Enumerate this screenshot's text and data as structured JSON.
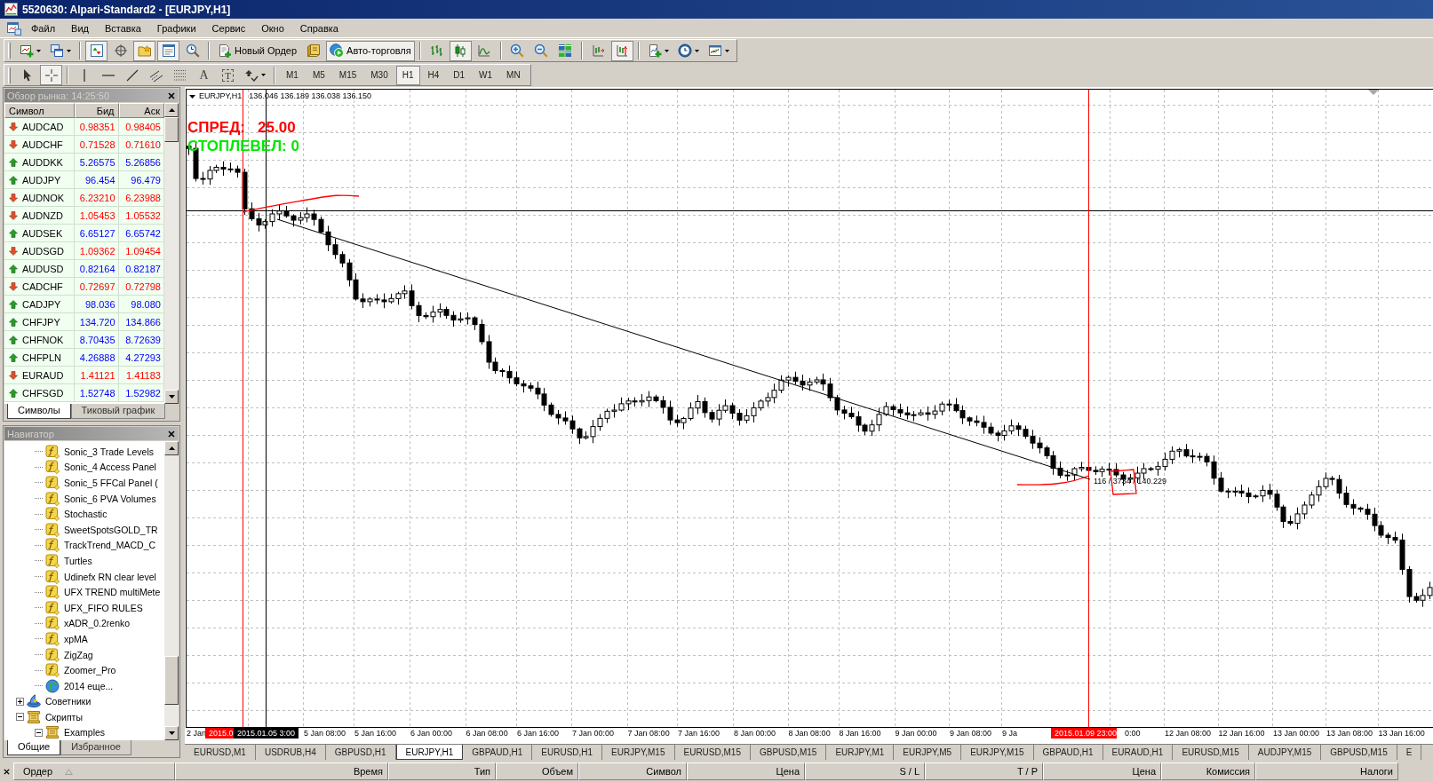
{
  "window": {
    "title": "5520630: Alpari-Standard2 - [EURJPY,H1]"
  },
  "menu": [
    "Файл",
    "Вид",
    "Вставка",
    "Графики",
    "Сервис",
    "Окно",
    "Справка"
  ],
  "toolbar": [
    [
      {
        "kind": "new-chart",
        "on": false
      },
      {
        "kind": "profiles",
        "on": false
      }
    ],
    [
      {
        "kind": "market-watch",
        "on": true
      },
      {
        "kind": "data-window",
        "on": false
      },
      {
        "kind": "navigator",
        "on": true
      },
      {
        "kind": "terminal",
        "on": true
      },
      {
        "kind": "strategy-tester",
        "on": false
      }
    ],
    [
      {
        "kind": "new-order",
        "label": "Новый Ордер",
        "on": false
      },
      {
        "kind": "meta-editor",
        "on": false
      },
      {
        "kind": "auto-trading",
        "label": "Авто-торговля",
        "on": true
      }
    ],
    [
      {
        "kind": "bar-chart",
        "on": false
      },
      {
        "kind": "candlesticks",
        "on": true
      },
      {
        "kind": "line-chart",
        "on": false
      }
    ],
    [
      {
        "kind": "zoom-in",
        "on": false
      },
      {
        "kind": "zoom-out",
        "on": false
      },
      {
        "kind": "tile-windows",
        "on": false
      }
    ],
    [
      {
        "kind": "chart-shift",
        "on": false
      },
      {
        "kind": "auto-scroll",
        "on": true
      }
    ],
    [
      {
        "kind": "indicators",
        "on": false
      },
      {
        "kind": "periods",
        "on": false
      },
      {
        "kind": "templates",
        "on": false
      }
    ]
  ],
  "drawing_toolbar": [
    [
      {
        "kind": "cursor",
        "on": false
      },
      {
        "kind": "crosshair",
        "on": true
      }
    ],
    [
      {
        "kind": "vertical-line",
        "on": false
      },
      {
        "kind": "horizontal-line",
        "on": false
      },
      {
        "kind": "trend-line",
        "on": false
      },
      {
        "kind": "channel",
        "on": false
      },
      {
        "kind": "fibonacci",
        "on": false
      },
      {
        "kind": "text",
        "label": "A",
        "on": false
      },
      {
        "kind": "text-label",
        "label": "T",
        "on": false
      },
      {
        "kind": "arrows",
        "on": false
      }
    ]
  ],
  "periods": [
    {
      "label": "M1",
      "selected": false
    },
    {
      "label": "M5",
      "selected": false
    },
    {
      "label": "M15",
      "selected": false
    },
    {
      "label": "M30",
      "selected": false
    },
    {
      "label": "H1",
      "selected": true
    },
    {
      "label": "H4",
      "selected": false
    },
    {
      "label": "D1",
      "selected": false
    },
    {
      "label": "W1",
      "selected": false
    },
    {
      "label": "MN",
      "selected": false
    }
  ],
  "market_watch": {
    "title": "Обзор рынка: 14:25:50",
    "columns": [
      "Символ",
      "Бид",
      "Аск"
    ],
    "rows": [
      {
        "symbol": "AUDCAD",
        "bid": "0.98351",
        "ask": "0.98405",
        "kind": "down"
      },
      {
        "symbol": "AUDCHF",
        "bid": "0.71528",
        "ask": "0.71610",
        "kind": "down"
      },
      {
        "symbol": "AUDDKK",
        "bid": "5.26575",
        "ask": "5.26856",
        "kind": "up"
      },
      {
        "symbol": "AUDJPY",
        "bid": "96.454",
        "ask": "96.479",
        "kind": "up"
      },
      {
        "symbol": "AUDNOK",
        "bid": "6.23210",
        "ask": "6.23988",
        "kind": "down"
      },
      {
        "symbol": "AUDNZD",
        "bid": "1.05453",
        "ask": "1.05532",
        "kind": "down"
      },
      {
        "symbol": "AUDSEK",
        "bid": "6.65127",
        "ask": "6.65742",
        "kind": "up"
      },
      {
        "symbol": "AUDSGD",
        "bid": "1.09362",
        "ask": "1.09454",
        "kind": "down"
      },
      {
        "symbol": "AUDUSD",
        "bid": "0.82164",
        "ask": "0.82187",
        "kind": "up"
      },
      {
        "symbol": "CADCHF",
        "bid": "0.72697",
        "ask": "0.72798",
        "kind": "down"
      },
      {
        "symbol": "CADJPY",
        "bid": "98.036",
        "ask": "98.080",
        "kind": "up"
      },
      {
        "symbol": "CHFJPY",
        "bid": "134.720",
        "ask": "134.866",
        "kind": "up"
      },
      {
        "symbol": "CHFNOK",
        "bid": "8.70435",
        "ask": "8.72639",
        "kind": "up"
      },
      {
        "symbol": "CHFPLN",
        "bid": "4.26888",
        "ask": "4.27293",
        "kind": "up"
      },
      {
        "symbol": "EURAUD",
        "bid": "1.41121",
        "ask": "1.41183",
        "kind": "down"
      },
      {
        "symbol": "CHFSGD",
        "bid": "1.52748",
        "ask": "1.52982",
        "kind": "up"
      }
    ],
    "tabs": [
      {
        "label": "Символы",
        "selected": true
      },
      {
        "label": "Тиковый график",
        "selected": false
      }
    ]
  },
  "navigator": {
    "title": "Навигатор",
    "tree": [
      {
        "children": [
          {
            "label": "Sonic_3 Trade Levels",
            "kind": "indicator"
          },
          {
            "label": "Sonic_4 Access Panel",
            "kind": "indicator"
          },
          {
            "label": "Sonic_5 FFCal Panel (",
            "kind": "indicator"
          },
          {
            "label": "Sonic_6 PVA Volumes",
            "kind": "indicator"
          },
          {
            "label": "Stochastic",
            "kind": "indicator"
          },
          {
            "label": "SweetSpotsGOLD_TR",
            "kind": "indicator"
          },
          {
            "label": "TrackTrend_MACD_C",
            "kind": "indicator"
          },
          {
            "label": "Turtles",
            "kind": "indicator"
          },
          {
            "label": "Udinefx RN clear level",
            "kind": "indicator"
          },
          {
            "label": "UFX TREND multiMete",
            "kind": "indicator"
          },
          {
            "label": "UFX_FIFO RULES",
            "kind": "indicator"
          },
          {
            "label": "xADR_0.2renko",
            "kind": "indicator"
          },
          {
            "label": "xpMA",
            "kind": "indicator"
          },
          {
            "label": "ZigZag",
            "kind": "indicator"
          },
          {
            "label": "Zoomer_Pro",
            "kind": "indicator"
          },
          {
            "label": "2014 еще...",
            "kind": "link"
          }
        ]
      },
      {
        "label": "Советники",
        "kind": "experts",
        "expanded": false
      },
      {
        "label": "Скрипты",
        "kind": "scripts",
        "expanded": true,
        "children": [
          {
            "label": "Examples",
            "kind": "scripts",
            "expanded": true
          }
        ]
      }
    ],
    "tabs": [
      {
        "label": "Общие",
        "selected": true
      },
      {
        "label": "Избранное",
        "selected": false
      }
    ]
  },
  "chart": {
    "symbol": "EURJPY,H1",
    "ohlc": "136.046 136.189 136.038 136.150",
    "spread": "СПРЕД:   25.00",
    "stop_level": "СТОПЛЕВЕЛ: 0",
    "readout": "116 / 3734 / 140.229",
    "time_axis": [
      {
        "label": "2 Jan",
        "kind": "tick"
      },
      {
        "label": "2015.0",
        "kind": "vline"
      },
      {
        "label": "2015.01.05 3:00",
        "kind": "crosshair"
      },
      {
        "label": "5 Jan 08:00",
        "kind": "tick"
      },
      {
        "label": "5 Jan 16:00",
        "kind": "tick"
      },
      {
        "label": "6 Jan 00:00",
        "kind": "tick"
      },
      {
        "label": "6 Jan 08:00",
        "kind": "tick"
      },
      {
        "label": "6 Jan 16:00",
        "kind": "tick"
      },
      {
        "label": "7 Jan 00:00",
        "kind": "tick"
      },
      {
        "label": "7 Jan 08:00",
        "kind": "tick"
      },
      {
        "label": "7 Jan 16:00",
        "kind": "tick"
      },
      {
        "label": "8 Jan 00:00",
        "kind": "tick"
      },
      {
        "label": "8 Jan 08:00",
        "kind": "tick"
      },
      {
        "label": "8 Jan 16:00",
        "kind": "tick"
      },
      {
        "label": "9 Jan 00:00",
        "kind": "tick"
      },
      {
        "label": "9 Jan 08:00",
        "kind": "tick"
      },
      {
        "label": "9 Ja",
        "kind": "tick"
      },
      {
        "label": "2015.01.09 23:00",
        "kind": "vline"
      },
      {
        "label": "0:00",
        "kind": "tick"
      },
      {
        "label": "12 Jan 08:00",
        "kind": "tick"
      },
      {
        "label": "12 Jan 16:00",
        "kind": "tick"
      },
      {
        "label": "13 Jan 00:00",
        "kind": "tick"
      },
      {
        "label": "13 Jan 08:00",
        "kind": "tick"
      },
      {
        "label": "13 Jan 16:00",
        "kind": "tick"
      }
    ]
  },
  "chart_tabs": [
    {
      "label": "EURUSD,M1",
      "selected": false
    },
    {
      "label": "USDRUB,H4",
      "selected": false
    },
    {
      "label": "GBPUSD,H1",
      "selected": false
    },
    {
      "label": "EURJPY,H1",
      "selected": true
    },
    {
      "label": "GBPAUD,H1",
      "selected": false
    },
    {
      "label": "EURUSD,H1",
      "selected": false
    },
    {
      "label": "EURJPY,M15",
      "selected": false
    },
    {
      "label": "EURUSD,M15",
      "selected": false
    },
    {
      "label": "GBPUSD,M15",
      "selected": false
    },
    {
      "label": "EURJPY,M1",
      "selected": false
    },
    {
      "label": "EURJPY,M5",
      "selected": false
    },
    {
      "label": "EURJPY,M15",
      "selected": false
    },
    {
      "label": "GBPAUD,H1",
      "selected": false
    },
    {
      "label": "EURAUD,H1",
      "selected": false
    },
    {
      "label": "EURUSD,M15",
      "selected": false
    },
    {
      "label": "AUDJPY,M15",
      "selected": false
    },
    {
      "label": "GBPUSD,M15",
      "selected": false
    },
    {
      "label": "E",
      "selected": false
    }
  ],
  "terminal": {
    "columns": [
      "Ордер",
      "Время",
      "Тип",
      "Объем",
      "Символ",
      "Цена",
      "S / L",
      "T / P",
      "Цена",
      "Комиссия",
      "Налоги"
    ]
  }
}
